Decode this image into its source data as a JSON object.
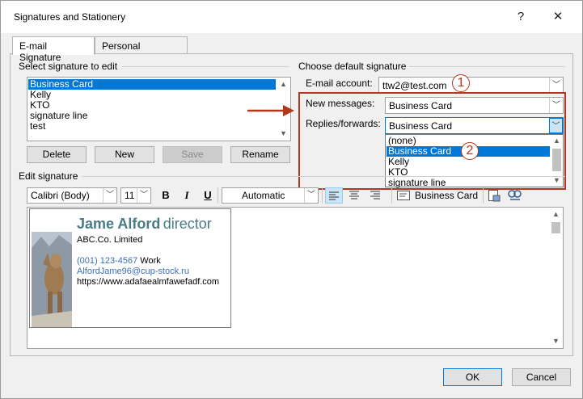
{
  "window": {
    "title": "Signatures and Stationery",
    "help_glyph": "?",
    "close_glyph": "✕"
  },
  "tabs": [
    {
      "label": "E-mail Signature",
      "active": true
    },
    {
      "label": "Personal Stationery",
      "active": false
    }
  ],
  "select_section": {
    "label": "Select signature to edit",
    "items": [
      "Business Card",
      "Kelly",
      "KTO",
      "signature line",
      "test"
    ],
    "selected_index": 0
  },
  "buttons": {
    "delete": "Delete",
    "new": "New",
    "save": "Save",
    "rename": "Rename",
    "ok": "OK",
    "cancel": "Cancel"
  },
  "default_section": {
    "label": "Choose default signature",
    "email_account_label": "E-mail account:",
    "email_account_value": "ttw2@test.com",
    "new_messages_label": "New messages:",
    "new_messages_value": "Business Card",
    "replies_label": "Replies/forwards:",
    "replies_value": "Business Card",
    "dropdown_options": [
      "(none)",
      "Business Card",
      "Kelly",
      "KTO",
      "signature line"
    ],
    "dropdown_selected_index": 1
  },
  "edit_section": {
    "label": "Edit signature",
    "font_name": "Calibri (Body)",
    "font_size": "11",
    "bold": "B",
    "italic": "I",
    "underline": "U",
    "color_value": "Automatic",
    "business_card_label": "Business Card"
  },
  "signature_card": {
    "name": "Jame Alford",
    "role": "director",
    "company": "ABC.Co. Limited",
    "phone": "(001) 123-4567",
    "phone_type": "Work",
    "email": "AlfordJame96@cup-stock.ru",
    "website": "https://www.adafaealmfawefadf.com"
  },
  "annotations": {
    "step1": "1",
    "step2": "2"
  },
  "colors": {
    "accent": "#0078d7",
    "annotation": "#b3371c",
    "name_color": "#4a7a86",
    "link_color": "#3b6fb6"
  }
}
